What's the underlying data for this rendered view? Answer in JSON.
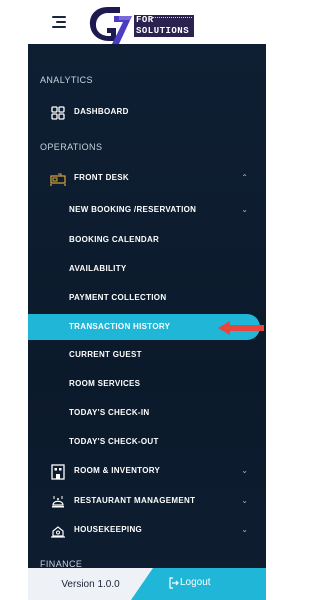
{
  "header": {
    "logo_top": "FOR",
    "logo_bottom": "SOLUTIONS"
  },
  "sidebar": {
    "sections": {
      "analytics": "ANALYTICS",
      "operations": "OPERATIONS",
      "finance": "FINANCE"
    },
    "items": {
      "dashboard": "DASHBOARD",
      "front_desk": "FRONT DESK",
      "new_booking": "NEW BOOKING /RESERVATION",
      "booking_calendar": "BOOKING CALENDAR",
      "availability": "AVAILABILITY",
      "payment_collection": "PAYMENT COLLECTION",
      "transaction_history": "TRANSACTION HISTORY",
      "current_guest": "CURRENT GUEST",
      "room_services": "ROOM SERVICES",
      "todays_checkin": "TODAY'S CHECK-IN",
      "todays_checkout": "TODAY'S CHECK-OUT",
      "room_inventory": "ROOM & INVENTORY",
      "restaurant_management": "RESTAURANT MANAGEMENT",
      "housekeeping": "HOUSEKEEPING"
    },
    "active_item": "TRANSACTION HISTORY"
  },
  "footer": {
    "version": "Version 1.0.0",
    "logout": "Logout"
  },
  "colors": {
    "sidebar_bg": "#0b1a2b",
    "accent": "#1fb6d7",
    "arrow": "#e8453c",
    "logo_purple": "#2b2250"
  },
  "icons": {
    "menu": "hamburger-icon",
    "dashboard": "grid-icon",
    "front_desk": "bed-icon",
    "room_inventory": "building-icon",
    "restaurant": "restaurant-icon",
    "housekeeping": "housekeeping-icon",
    "logout": "logout-icon"
  }
}
